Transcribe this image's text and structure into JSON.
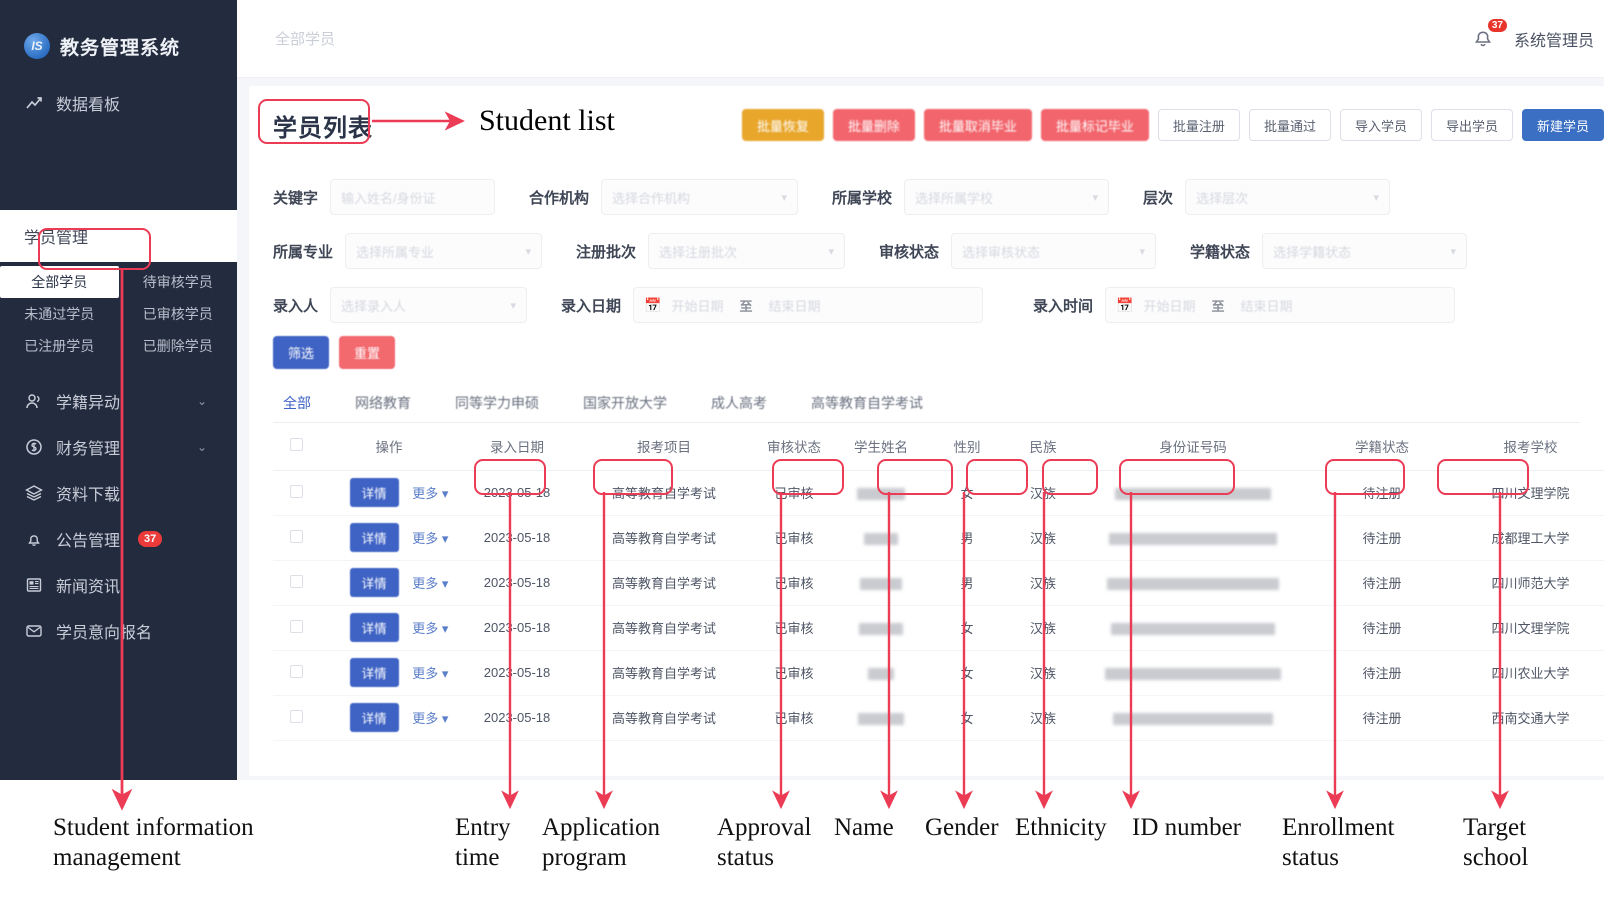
{
  "app": {
    "brand_title": "教务管理系统",
    "brand_logo_text": "IS"
  },
  "sidebar": {
    "dashboard": {
      "label": "数据看板",
      "icon": "chart-line-icon"
    },
    "group_header": {
      "label": "学员管理"
    },
    "submenu": [
      {
        "label": "全部学员",
        "active": true
      },
      {
        "label": "待审核学员",
        "active": false
      },
      {
        "label": "未通过学员",
        "active": false
      },
      {
        "label": "已审核学员",
        "active": false
      },
      {
        "label": "已注册学员",
        "active": false
      },
      {
        "label": "已删除学员",
        "active": false
      }
    ],
    "items": [
      {
        "label": "学籍异动",
        "icon": "user-group-icon",
        "chevron": "⌄",
        "badge": ""
      },
      {
        "label": "财务管理",
        "icon": "dollar-circle-icon",
        "chevron": "⌄",
        "badge": ""
      },
      {
        "label": "资料下载",
        "icon": "layers-icon",
        "chevron": "",
        "badge": ""
      },
      {
        "label": "公告管理",
        "icon": "bell-icon",
        "chevron": "",
        "badge": "37"
      },
      {
        "label": "新闻资讯",
        "icon": "news-icon",
        "chevron": "",
        "badge": ""
      },
      {
        "label": "学员意向报名",
        "icon": "envelope-icon",
        "chevron": "",
        "badge": ""
      }
    ]
  },
  "topbar": {
    "breadcrumb": "全部学员",
    "notification_count": "37",
    "user_name": "系统管理员",
    "bell_icon": "bell-icon"
  },
  "page": {
    "title": "学员列表",
    "title_translation": "Student list"
  },
  "toolbar": {
    "buttons": [
      {
        "label": "批量恢复",
        "style": "orange"
      },
      {
        "label": "批量删除",
        "style": "red"
      },
      {
        "label": "批量取消毕业",
        "style": "red"
      },
      {
        "label": "批量标记毕业",
        "style": "red"
      },
      {
        "label": "批量注册",
        "style": "white"
      },
      {
        "label": "批量通过",
        "style": "white"
      },
      {
        "label": "导入学员",
        "style": "white"
      },
      {
        "label": "导出学员",
        "style": "white"
      },
      {
        "label": "新建学员",
        "style": "blue"
      }
    ]
  },
  "filters": {
    "row1": [
      {
        "label": "关键字",
        "placeholder": "输入姓名/身份证",
        "type": "input",
        "width": "w-keyword"
      },
      {
        "label": "合作机构",
        "placeholder": "选择合作机构",
        "type": "select",
        "width": "w-sel-md"
      },
      {
        "label": "所属学校",
        "placeholder": "选择所属学校",
        "type": "select",
        "width": "w-sel-lg"
      },
      {
        "label": "层次",
        "placeholder": "选择层次",
        "type": "select",
        "width": "w-sel-lg"
      }
    ],
    "row2": [
      {
        "label": "所属专业",
        "placeholder": "选择所属专业",
        "type": "select",
        "width": "w-sel-md"
      },
      {
        "label": "注册批次",
        "placeholder": "选择注册批次",
        "type": "select",
        "width": "w-sel-md"
      },
      {
        "label": "审核状态",
        "placeholder": "选择审核状态",
        "type": "select",
        "width": "w-sel-lg"
      },
      {
        "label": "学籍状态",
        "placeholder": "选择学籍状态",
        "type": "select",
        "width": "w-sel-lg"
      }
    ],
    "row3": [
      {
        "label": "录入人",
        "placeholder": "选择录入人",
        "type": "select",
        "width": "w-sel-md"
      },
      {
        "label": "录入日期",
        "type": "daterange",
        "start_placeholder": "开始日期",
        "end_placeholder": "结束日期",
        "separator": "至",
        "width": "w-date"
      },
      {
        "label": "录入时间",
        "type": "daterange",
        "start_placeholder": "开始日期",
        "end_placeholder": "结束日期",
        "separator": "至",
        "width": "w-date"
      }
    ],
    "actions": {
      "search_label": "筛选",
      "reset_label": "重置"
    }
  },
  "tabs": [
    {
      "label": "全部",
      "active": true
    },
    {
      "label": "网络教育",
      "active": false
    },
    {
      "label": "同等学力申硕",
      "active": false
    },
    {
      "label": "国家开放大学",
      "active": false
    },
    {
      "label": "成人高考",
      "active": false
    },
    {
      "label": "高等教育自学考试",
      "active": false
    }
  ],
  "table": {
    "columns": [
      {
        "key": "checkbox",
        "label": ""
      },
      {
        "key": "operation",
        "label": "操作"
      },
      {
        "key": "entry_date",
        "label": "录入日期"
      },
      {
        "key": "program",
        "label": "报考项目"
      },
      {
        "key": "approval_status",
        "label": "审核状态"
      },
      {
        "key": "name",
        "label": "学生姓名"
      },
      {
        "key": "gender",
        "label": "性别"
      },
      {
        "key": "ethnicity",
        "label": "民族"
      },
      {
        "key": "id_number",
        "label": "身份证号码"
      },
      {
        "key": "enroll_status",
        "label": "学籍状态"
      },
      {
        "key": "target_school",
        "label": "报考学校"
      }
    ],
    "row_action": {
      "detail_label": "详情",
      "more_label": "更多",
      "more_caret": "⌄"
    },
    "rows": [
      {
        "entry_date": "2023-05-18",
        "program": "高等教育自学考试",
        "approval_status": "已审核",
        "name": "",
        "gender": "女",
        "ethnicity": "汉族",
        "id_number": "",
        "enroll_status": "待注册",
        "target_school": "四川文理学院"
      },
      {
        "entry_date": "2023-05-18",
        "program": "高等教育自学考试",
        "approval_status": "已审核",
        "name": "",
        "gender": "男",
        "ethnicity": "汉族",
        "id_number": "",
        "enroll_status": "待注册",
        "target_school": "成都理工大学"
      },
      {
        "entry_date": "2023-05-18",
        "program": "高等教育自学考试",
        "approval_status": "已审核",
        "name": "",
        "gender": "男",
        "ethnicity": "汉族",
        "id_number": "",
        "enroll_status": "待注册",
        "target_school": "四川师范大学"
      },
      {
        "entry_date": "2023-05-18",
        "program": "高等教育自学考试",
        "approval_status": "已审核",
        "name": "",
        "gender": "女",
        "ethnicity": "汉族",
        "id_number": "",
        "enroll_status": "待注册",
        "target_school": "四川文理学院"
      },
      {
        "entry_date": "2023-05-18",
        "program": "高等教育自学考试",
        "approval_status": "已审核",
        "name": "",
        "gender": "女",
        "ethnicity": "汉族",
        "id_number": "",
        "enroll_status": "待注册",
        "target_school": "四川农业大学"
      },
      {
        "entry_date": "2023-05-18",
        "program": "高等教育自学考试",
        "approval_status": "已审核",
        "name": "",
        "gender": "女",
        "ethnicity": "汉族",
        "id_number": "",
        "enroll_status": "待注册",
        "target_school": "西南交通大学"
      }
    ]
  },
  "annotations": {
    "title_translation": "Student list",
    "callouts": [
      {
        "id": "student-information-management",
        "line1": "Student information",
        "line2": "management"
      },
      {
        "id": "entry-time",
        "line1": "Entry",
        "line2": "time"
      },
      {
        "id": "application-program",
        "line1": "Application",
        "line2": "program"
      },
      {
        "id": "approval-status",
        "line1": "Approval",
        "line2": "status"
      },
      {
        "id": "name",
        "line1": "Name",
        "line2": ""
      },
      {
        "id": "gender",
        "line1": "Gender",
        "line2": ""
      },
      {
        "id": "ethnicity",
        "line1": "Ethnicity",
        "line2": ""
      },
      {
        "id": "id-number",
        "line1": "ID number",
        "line2": ""
      },
      {
        "id": "enrollment-status",
        "line1": "Enrollment",
        "line2": "status"
      },
      {
        "id": "target-school",
        "line1": "Target",
        "line2": "school"
      }
    ]
  },
  "colors": {
    "accent_blue": "#3f63c4",
    "annotation_red": "#ec3b55",
    "sidebar_bg": "#232b3e",
    "danger_red": "#f2656c",
    "warning_orange": "#e8a62b",
    "success_green": "#7ab648"
  }
}
